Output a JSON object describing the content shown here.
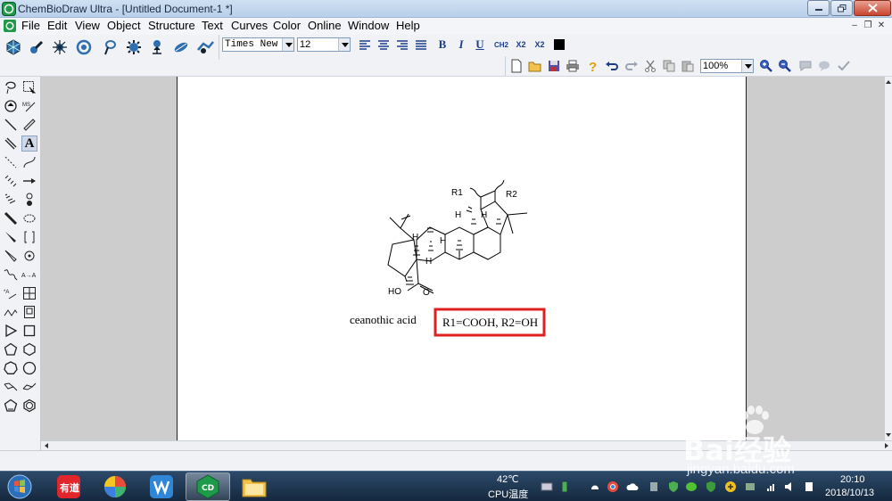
{
  "window": {
    "title": "ChemBioDraw Ultra - [Untitled Document-1 *]"
  },
  "menubar": {
    "items": [
      "File",
      "Edit",
      "View",
      "Object",
      "Structure",
      "Text",
      "Curves",
      "Color",
      "Online",
      "Window",
      "Help"
    ]
  },
  "formatting": {
    "font_name": "Times New R",
    "font_size": "12",
    "bold": "B",
    "italic": "I",
    "underline": "U",
    "formula_label": "CH2",
    "subscript_label": "X2",
    "superscript_label": "X2",
    "color_swatch": "#000000"
  },
  "standard_toolbar": {
    "zoom": "100%"
  },
  "drawing": {
    "atom_labels": {
      "r1": "R1",
      "r2": "R2",
      "h_top_left": "H",
      "h_top_right": "H",
      "h_mid": "H",
      "h_lower": "H",
      "h_bottom": "H",
      "acid_ho": "HO",
      "acid_o": "O"
    },
    "compound_name": "ceanothic acid",
    "substituents": "R1=COOH, R2=OH",
    "highlight_color": "#e02020"
  },
  "taskbar": {
    "apps": [
      "youdao-dict",
      "color-app",
      "wps-writer",
      "chembiodraw",
      "file-explorer"
    ],
    "cpu_temp": "42℃",
    "cpu_label": "CPU温度",
    "time": "20:10",
    "date": "2018/10/13"
  },
  "watermark": {
    "brand": "Bai经验",
    "url": "jingyan.baidu.com"
  }
}
